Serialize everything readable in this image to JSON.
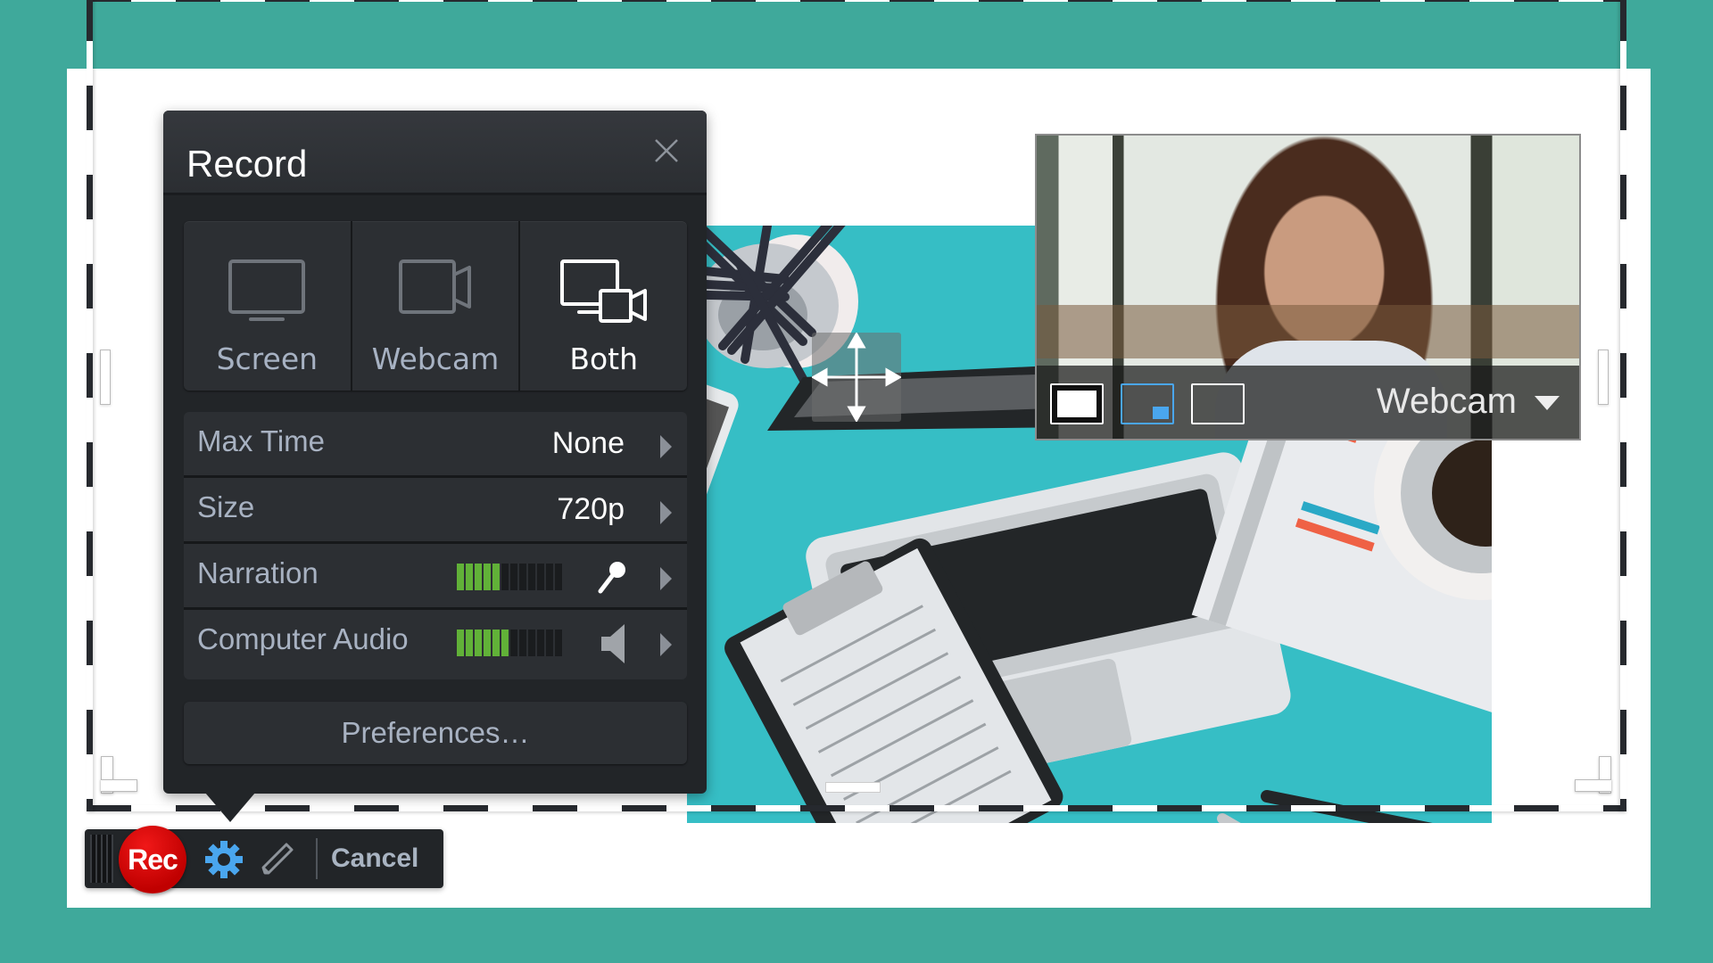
{
  "colors": {
    "background": "#3FA99B",
    "dialog": "#222528",
    "accent_blue": "#4aa6ee",
    "rec_red": "#d40000",
    "meter_green": "#61b138",
    "illustration_teal": "#36BEC5"
  },
  "record_dialog": {
    "title": "Record",
    "close_icon": "close-icon",
    "modes": [
      {
        "label": "Screen",
        "icon": "monitor-icon",
        "active": false
      },
      {
        "label": "Webcam",
        "icon": "video-camera-icon",
        "active": false
      },
      {
        "label": "Both",
        "icon": "monitor-and-camera-icon",
        "active": true
      }
    ],
    "settings": [
      {
        "label": "Max Time",
        "value": "None"
      },
      {
        "label": "Size",
        "value": "720p"
      },
      {
        "label": "Narration",
        "meter_level": 5,
        "meter_total": 12,
        "icon": "microphone-icon"
      },
      {
        "label": "Computer Audio",
        "meter_level": 6,
        "meter_total": 12,
        "icon": "speaker-icon"
      }
    ],
    "preferences_label": "Preferences…"
  },
  "webcam_preview": {
    "source_label": "Webcam",
    "layouts": [
      "webcam-fullscreen",
      "picture-in-picture",
      "screen-only"
    ],
    "selected_layout": "picture-in-picture"
  },
  "toolbar": {
    "rec_label": "Rec",
    "cancel_label": "Cancel"
  }
}
